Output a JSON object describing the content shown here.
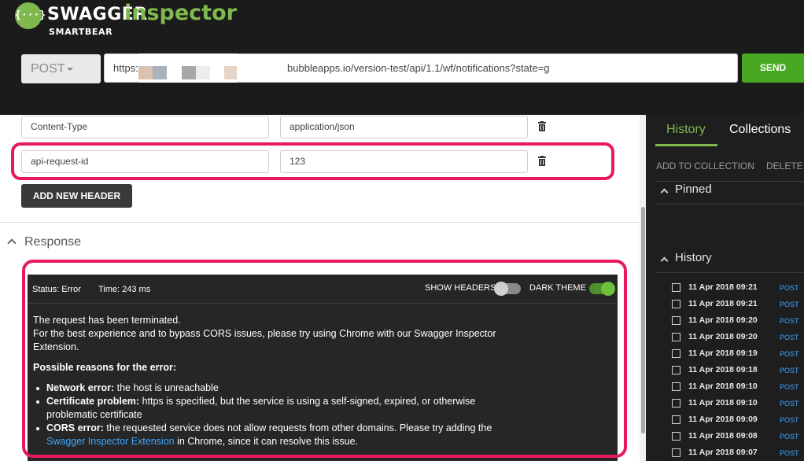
{
  "brand": {
    "logo_glyph": "{···}",
    "name": "SWAGGER",
    "product": "inspector",
    "company": "SMARTBEAR",
    "accent_color": "#7fb84e"
  },
  "request": {
    "method": "POST",
    "url": "https://                            bubbleapps.io/version-test/api/1.1/wf/notifications?state=g",
    "send_label": "SEND"
  },
  "headers": [
    {
      "key": "Content-Type",
      "value": "application/json"
    },
    {
      "key": "api-request-id",
      "value": "123"
    }
  ],
  "add_header_label": "ADD NEW HEADER",
  "response": {
    "section_title": "Response",
    "status": "Status: Error",
    "time": "Time: 243 ms",
    "show_headers_label": "SHOW HEADERS",
    "show_headers_on": false,
    "dark_theme_label": "DARK THEME",
    "dark_theme_on": true,
    "message_line1": "The request has been terminated.",
    "message_line2": "For the best experience and to bypass CORS issues, please try using Chrome with our Swagger Inspector",
    "message_line3": "Extension.",
    "reasons_title": "Possible reasons for the error:",
    "reasons": [
      {
        "title": "Network error:",
        "text": " the host is unreachable"
      },
      {
        "title": "Certificate problem:",
        "text": " https is specified, but the service is using a self-signed, expired, or otherwise",
        "text2": "problematic certificate"
      },
      {
        "title": "CORS error:",
        "text": " the requested service does not allow requests from other domains. Please try adding the",
        "link": "Swagger Inspector Extension",
        "text2": " in Chrome, since it can resolve this issue."
      }
    ]
  },
  "sidebar": {
    "tabs": [
      "History",
      "Collections"
    ],
    "active_tab": "History",
    "actions": [
      "ADD TO COLLECTION",
      "DELETE"
    ],
    "pinned_title": "Pinned",
    "history_title": "History",
    "history": [
      {
        "date": "11 Apr 2018 09:21",
        "method": "POST"
      },
      {
        "date": "11 Apr 2018 09:21",
        "method": "POST"
      },
      {
        "date": "11 Apr 2018 09:20",
        "method": "POST"
      },
      {
        "date": "11 Apr 2018 09:20",
        "method": "POST"
      },
      {
        "date": "11 Apr 2018 09:19",
        "method": "POST"
      },
      {
        "date": "11 Apr 2018 09:18",
        "method": "POST"
      },
      {
        "date": "11 Apr 2018 09:10",
        "method": "POST"
      },
      {
        "date": "11 Apr 2018 09:10",
        "method": "POST"
      },
      {
        "date": "11 Apr 2018 09:09",
        "method": "POST"
      },
      {
        "date": "11 Apr 2018 09:08",
        "method": "POST"
      },
      {
        "date": "11 Apr 2018 09:07",
        "method": "POST"
      }
    ]
  }
}
